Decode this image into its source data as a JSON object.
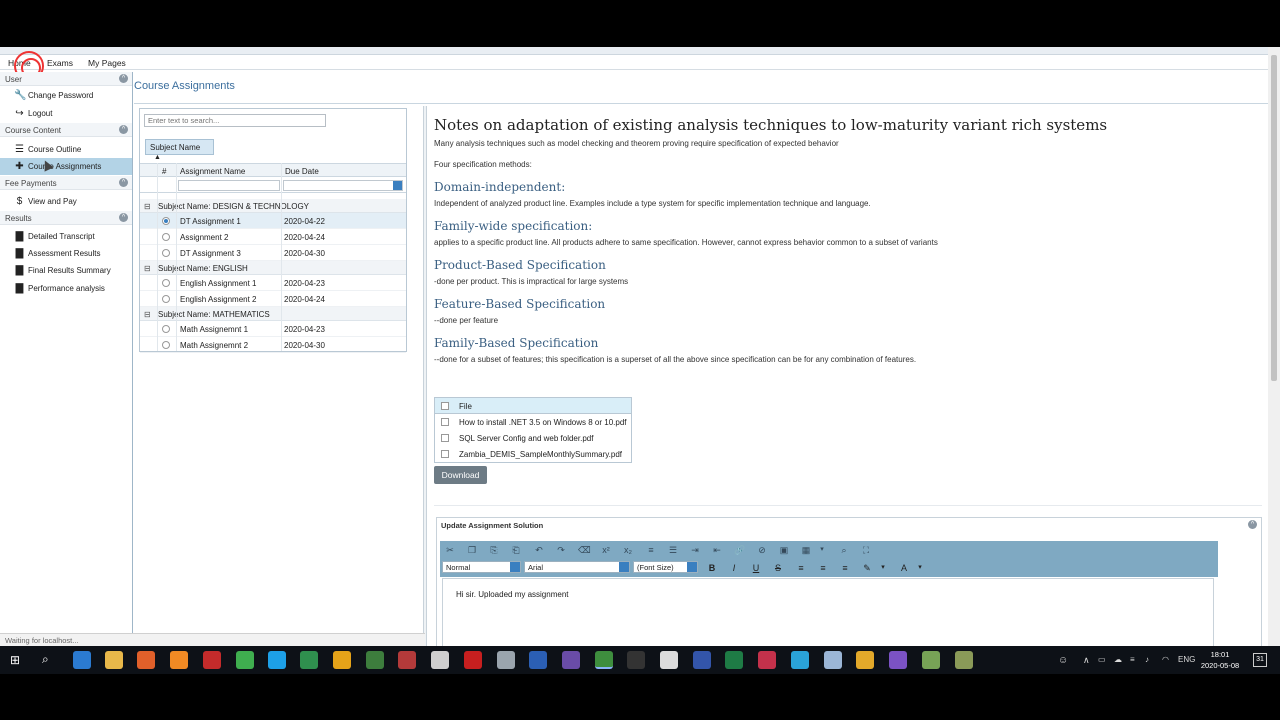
{
  "menu": {
    "home": "Home",
    "exams": "Exams",
    "my_pages": "My Pages"
  },
  "sidebar": {
    "user_header": "User",
    "change_password": "Change Password",
    "logout": "Logout",
    "content_header": "Course Content",
    "course_outline": "Course Outline",
    "course_assignments": "Course Assignments",
    "fees_header": "Fee Payments",
    "view_and_pay": "View and Pay",
    "results_header": "Results",
    "detailed_transcript": "Detailed Transcript",
    "assessment_results": "Assessment Results",
    "final_results_summary": "Final Results Summary",
    "performance_analysis": "Performance analysis"
  },
  "page": {
    "title": "Course Assignments"
  },
  "grid": {
    "search_placeholder": "Enter text to search...",
    "group_button": "Subject Name",
    "col_num": "#",
    "col_name": "Assignment Name",
    "col_due": "Due Date",
    "groups": [
      {
        "label": "Subject Name: DESIGN & TECHNOLOGY",
        "rows": [
          {
            "name": "DT Assignment 1",
            "due": "2020-04-22"
          },
          {
            "name": "Assignment 2",
            "due": "2020-04-24"
          },
          {
            "name": "DT Assignment 3",
            "due": "2020-04-30"
          }
        ]
      },
      {
        "label": "Subject Name: ENGLISH",
        "rows": [
          {
            "name": "English Assignment 1",
            "due": "2020-04-23"
          },
          {
            "name": "English Assignment 2",
            "due": "2020-04-24"
          }
        ]
      },
      {
        "label": "Subject Name: MATHEMATICS",
        "rows": [
          {
            "name": "Math Assignemnt 1",
            "due": "2020-04-23"
          },
          {
            "name": "Math Assignemnt 2",
            "due": "2020-04-30"
          }
        ]
      }
    ]
  },
  "notes": {
    "title": "Notes on adaptation of existing analysis techniques to low-maturity variant rich systems",
    "intro": "Many analysis techniques such as model checking and theorem proving require specification of expected behavior",
    "methods_label": "Four specification methods:",
    "sections": [
      {
        "heading": "Domain-independent:",
        "text": "Independent of analyzed product line. Examples include a type system for specific implementation technique and language."
      },
      {
        "heading": "Family-wide specification:",
        "text": "applies to a specific product line. All products adhere to same specification. However, cannot express behavior common to a subset of variants"
      },
      {
        "heading": "Product-Based Specification",
        "text": "-done per product. This is impractical for large systems"
      },
      {
        "heading": "Feature-Based Specification",
        "text": "--done per feature"
      },
      {
        "heading": "Family-Based Specification",
        "text": "--done for a subset of features; this specification is a superset of all the above since specification can be for any combination of features."
      }
    ]
  },
  "files": {
    "header": "File",
    "items": [
      "How to install .NET 3.5 on Windows 8 or 10.pdf",
      "SQL Server Config and web folder.pdf",
      "Zambia_DEMIS_SampleMonthlySummary.pdf"
    ],
    "download": "Download"
  },
  "editor": {
    "title": "Update Assignment Solution",
    "format_value": "Normal",
    "font_value": "Arial",
    "size_value": "(Font Size)",
    "bold": "B",
    "italic": "I",
    "underline": "U",
    "strike": "S",
    "fontcolor": "A",
    "body_text": "Hi sir. Uploaded my assignment"
  },
  "status": {
    "text": "Waiting for localhost..."
  },
  "taskbar": {
    "lang": "ENG",
    "time": "18:01",
    "date": "2020-05-08",
    "notif": "31"
  }
}
